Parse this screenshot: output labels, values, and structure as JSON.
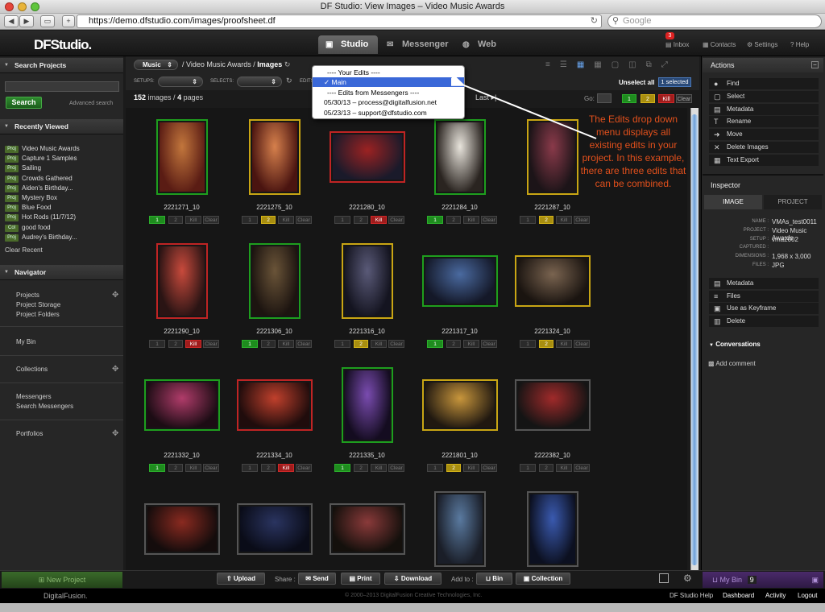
{
  "browser": {
    "title": "DF Studio: View Images – Video Music Awards",
    "url": "https://demo.dfstudio.com/images/proofsheet.df",
    "search_placeholder": "Google",
    "back": "◀",
    "forward": "▶",
    "add": "+"
  },
  "header": {
    "logo": "DFStudio.",
    "tabs": [
      {
        "label": "Studio",
        "icon": "monitor-icon"
      },
      {
        "label": "Messenger",
        "icon": "envelope-icon"
      },
      {
        "label": "Web",
        "icon": "globe-icon"
      }
    ],
    "links": {
      "inbox": "Inbox",
      "inbox_count": "3",
      "contacts": "Contacts",
      "settings": "Settings",
      "help": "Help"
    }
  },
  "left": {
    "search_header": "Search Projects",
    "search_button": "Search",
    "advanced": "Advanced search",
    "recent_header": "Recently Viewed",
    "recent": [
      {
        "tag": "Proj",
        "label": "Video Music Awards"
      },
      {
        "tag": "Proj",
        "label": "Capture 1 Samples"
      },
      {
        "tag": "Proj",
        "label": "Sailing"
      },
      {
        "tag": "Proj",
        "label": "Crowds Gathered"
      },
      {
        "tag": "Proj",
        "label": "Aiden's Birthday..."
      },
      {
        "tag": "Proj",
        "label": "Mystery Box"
      },
      {
        "tag": "Proj",
        "label": "Blue Food"
      },
      {
        "tag": "Proj",
        "label": "Hot Rods (11/7/12)"
      },
      {
        "tag": "Col",
        "label": "good food"
      },
      {
        "tag": "Proj",
        "label": "Audrey's Birthday..."
      }
    ],
    "clear_recent": "Clear Recent",
    "navigator_header": "Navigator",
    "nav": {
      "projects": "Projects",
      "storage": "Project Storage",
      "folders": "Project Folders",
      "bin": "My Bin",
      "collections": "Collections",
      "messengers": "Messengers",
      "search_messengers": "Search Messengers",
      "portfolios": "Portfolios"
    },
    "new_project": "New Project"
  },
  "toolbar": {
    "breadcrumb_root": "Music",
    "breadcrumb_project": "Video Music Awards",
    "breadcrumb_sep": "/",
    "breadcrumb_current": "Images",
    "setups": "SETUPS:",
    "selects": "SELECTS:",
    "edits": "EDITS:",
    "count_images": "152",
    "images_word": "images /",
    "count_pages": "4",
    "pages_word": "pages",
    "last": "Last",
    "go": "Go:",
    "unselect_all": "Unselect all",
    "selected_count": "1 selected",
    "filter": [
      "1",
      "2",
      "Kill",
      "Clear"
    ]
  },
  "edits_menu": {
    "items": [
      {
        "label": "---- Your Edits ----",
        "selected": false,
        "header": true
      },
      {
        "label": "✓ Main",
        "selected": true,
        "header": false
      },
      {
        "label": "---- Edits from Messengers ----",
        "selected": false,
        "header": true
      },
      {
        "label": "05/30/13 – process@digitalfusion.net",
        "selected": false,
        "header": false
      },
      {
        "label": "05/23/13 – support@dfstudio.com",
        "selected": false,
        "header": false
      }
    ]
  },
  "callout": "The Edits drop down menu displays all existing edits in your project. In this example, there are three edits that can be combined.",
  "rating_labels": [
    "1",
    "2",
    "Kill",
    "Clear"
  ],
  "images": [
    {
      "name": "2221271_10",
      "border": "g",
      "rating": "1",
      "orient": "portrait",
      "colors": [
        "#c2763c",
        "#5a1c14"
      ]
    },
    {
      "name": "2221275_10",
      "border": "y",
      "rating": "2",
      "orient": "portrait",
      "colors": [
        "#d6804c",
        "#4a1410"
      ]
    },
    {
      "name": "2221280_10",
      "border": "r",
      "rating": "Kill",
      "orient": "landscape",
      "colors": [
        "#9c2222",
        "#1a1a2a"
      ]
    },
    {
      "name": "2221284_10",
      "border": "g",
      "rating": "1",
      "orient": "portrait",
      "colors": [
        "#e8e4dc",
        "#2a2420"
      ]
    },
    {
      "name": "2221287_10",
      "border": "y",
      "rating": "2",
      "orient": "portrait",
      "colors": [
        "#8a3a4a",
        "#1c1418"
      ]
    },
    {
      "name": "2221290_10",
      "border": "r",
      "rating": "Kill",
      "orient": "portrait",
      "colors": [
        "#c84a3c",
        "#2a1414"
      ]
    },
    {
      "name": "2221306_10",
      "border": "g",
      "rating": "1",
      "orient": "portrait",
      "colors": [
        "#6a5438",
        "#1c1410"
      ]
    },
    {
      "name": "2221316_10",
      "border": "y",
      "rating": "2",
      "orient": "portrait",
      "colors": [
        "#5a5a78",
        "#141420"
      ]
    },
    {
      "name": "2221317_10",
      "border": "g",
      "rating": "1",
      "orient": "landscape",
      "colors": [
        "#4a6aa0",
        "#141828"
      ]
    },
    {
      "name": "2221324_10",
      "border": "y",
      "rating": "2",
      "orient": "landscape",
      "colors": [
        "#7a6450",
        "#1a1410"
      ]
    },
    {
      "name": "2221332_10",
      "border": "g",
      "rating": "1",
      "orient": "landscape",
      "colors": [
        "#b03c6a",
        "#1c0c14"
      ]
    },
    {
      "name": "2221334_10",
      "border": "r",
      "rating": "Kill",
      "orient": "landscape",
      "colors": [
        "#c0402c",
        "#200c0c"
      ]
    },
    {
      "name": "2221335_10",
      "border": "g",
      "rating": "1",
      "orient": "portrait",
      "colors": [
        "#7a4cb0",
        "#140c20"
      ]
    },
    {
      "name": "2221801_10",
      "border": "y",
      "rating": "2",
      "orient": "landscape",
      "colors": [
        "#c8963c",
        "#201810"
      ]
    },
    {
      "name": "2222382_10",
      "border": "n",
      "rating": "",
      "orient": "landscape",
      "colors": [
        "#a02a2a",
        "#141414"
      ]
    },
    {
      "name": "",
      "border": "n",
      "rating": "",
      "orient": "landscape",
      "colors": [
        "#8a2a20",
        "#140c0c"
      ]
    },
    {
      "name": "",
      "border": "n",
      "rating": "",
      "orient": "landscape",
      "colors": [
        "#2a3460",
        "#0a0c18"
      ]
    },
    {
      "name": "",
      "border": "n",
      "rating": "",
      "orient": "landscape",
      "colors": [
        "#8a3a3a",
        "#14100c"
      ]
    },
    {
      "name": "",
      "border": "n",
      "rating": "",
      "orient": "portrait",
      "colors": [
        "#5a7aa0",
        "#1a1e28"
      ]
    },
    {
      "name": "",
      "border": "n",
      "rating": "",
      "orient": "portrait",
      "colors": [
        "#3a5ab0",
        "#0c1020"
      ]
    }
  ],
  "bottom": {
    "upload": "Upload",
    "share": "Share :",
    "send": "Send",
    "print": "Print",
    "download": "Download",
    "add_to": "Add to :",
    "bin": "Bin",
    "collection": "Collection",
    "mybin": "My Bin",
    "mybin_count": "9"
  },
  "footer": {
    "brand": "DigitalFusion.",
    "copyright": "© 2000–2013 DigitalFusion Creative Technologies, Inc.",
    "help": "DF Studio Help",
    "dashboard": "Dashboard",
    "activity": "Activity",
    "logout": "Logout"
  },
  "right": {
    "actions_header": "Actions",
    "actions": [
      {
        "label": "Find",
        "icon": "dot-icon",
        "glyph": "●"
      },
      {
        "label": "Select",
        "icon": "select-icon",
        "glyph": "▢"
      },
      {
        "label": "Metadata",
        "icon": "metadata-icon",
        "glyph": "▤"
      },
      {
        "label": "Rename",
        "icon": "rename-icon",
        "glyph": "T"
      },
      {
        "label": "Move",
        "icon": "move-icon",
        "glyph": "➜"
      },
      {
        "label": "Delete Images",
        "icon": "delete-icon",
        "glyph": "✕"
      },
      {
        "label": "Text Export",
        "icon": "export-icon",
        "glyph": "▦"
      }
    ],
    "inspector_header": "Inspector",
    "inspector_tabs": [
      "IMAGE",
      "PROJECT"
    ],
    "inspector_fields": [
      {
        "key": "NAME :",
        "value": "VMAs_test0011"
      },
      {
        "key": "PROJECT :",
        "value": "Video Music Awards"
      },
      {
        "key": "SETUP :",
        "value": "vma2002"
      },
      {
        "key": "CAPTURED :",
        "value": ""
      },
      {
        "key": "DIMENSIONS :",
        "value": "1,968 x 3,000"
      },
      {
        "key": "FILES :",
        "value": "JPG"
      }
    ],
    "inspector_actions": [
      {
        "label": "Metadata",
        "icon": "metadata-icon",
        "glyph": "▤"
      },
      {
        "label": "Files",
        "icon": "files-icon",
        "glyph": "≡"
      },
      {
        "label": "Use as Keyframe",
        "icon": "keyframe-icon",
        "glyph": "▣"
      },
      {
        "label": "Delete",
        "icon": "trash-icon",
        "glyph": "▥"
      }
    ],
    "conversations": "Conversations",
    "add_comment": "Add comment"
  }
}
